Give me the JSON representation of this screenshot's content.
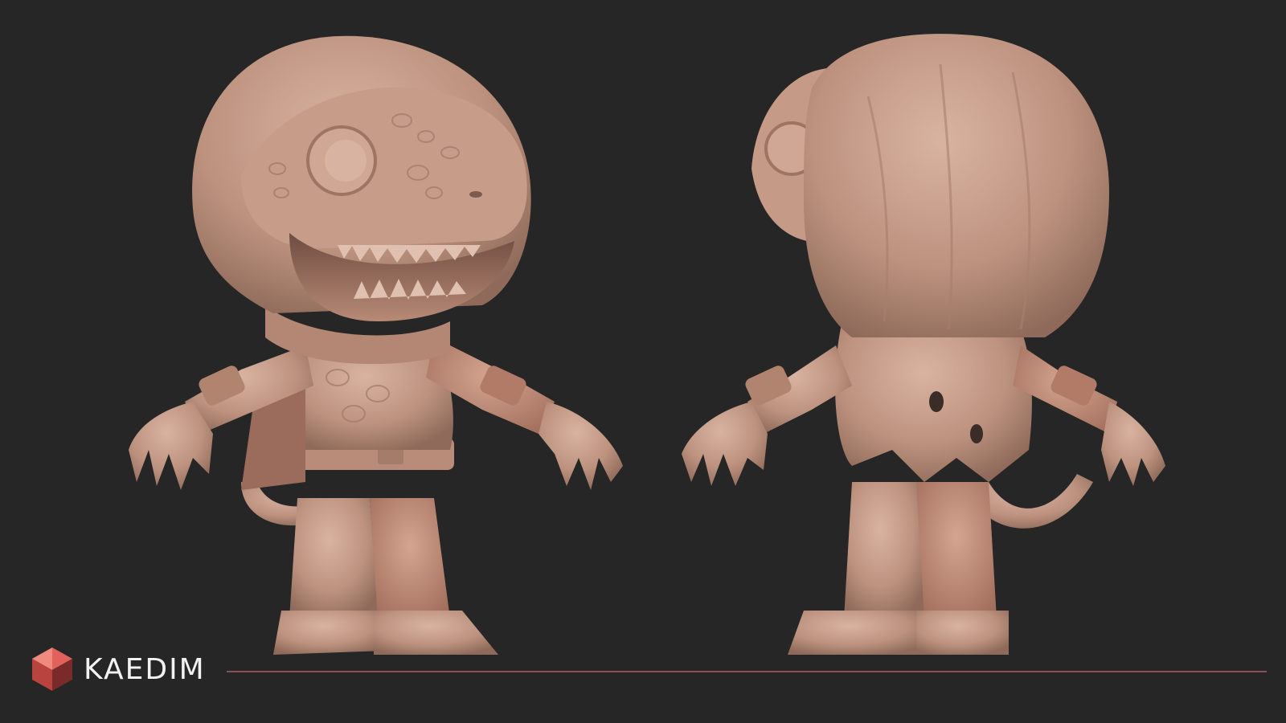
{
  "brand": {
    "name": "KAEDIM",
    "accent_color": "#c9534e",
    "divider_color": "#8a4f57"
  },
  "scene": {
    "background_color": "#262626",
    "clay_color": "#c9a08e",
    "views": [
      "front-three-quarter",
      "back-three-quarter"
    ]
  }
}
